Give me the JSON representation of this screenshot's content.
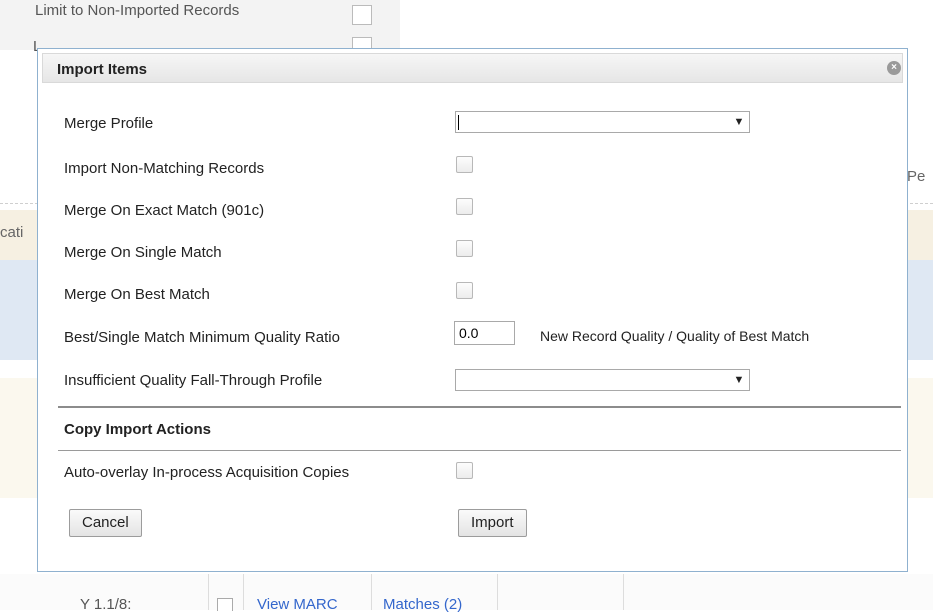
{
  "background": {
    "top_label": "Limit to Non-Imported Records",
    "top_fragment": "L",
    "left_fragment": "cati",
    "right_fragment": "Pe",
    "row_call_number": "Y 1.1/8:",
    "row_links": [
      "View MARC",
      "Matches (2)"
    ]
  },
  "dialog": {
    "title": "Import Items",
    "close_icon": "close-circle-icon",
    "fields": {
      "merge_profile": {
        "label": "Merge Profile",
        "value": ""
      },
      "import_non_matching": {
        "label": "Import Non-Matching Records",
        "checked": false
      },
      "merge_exact": {
        "label": "Merge On Exact Match (901c)",
        "checked": false
      },
      "merge_single": {
        "label": "Merge On Single Match",
        "checked": false
      },
      "merge_best": {
        "label": "Merge On Best Match",
        "checked": false
      },
      "min_quality_ratio": {
        "label": "Best/Single Match Minimum Quality Ratio",
        "value": "0.0",
        "hint": "New Record Quality / Quality of Best Match"
      },
      "fallthrough_profile": {
        "label": "Insufficient Quality Fall-Through Profile",
        "value": ""
      }
    },
    "copy_section": {
      "title": "Copy Import Actions",
      "auto_overlay": {
        "label": "Auto-overlay In-process Acquisition Copies",
        "checked": false
      }
    },
    "buttons": {
      "cancel": "Cancel",
      "import": "Import"
    }
  },
  "dropdown_arrow": "▼",
  "close_glyph": "×"
}
